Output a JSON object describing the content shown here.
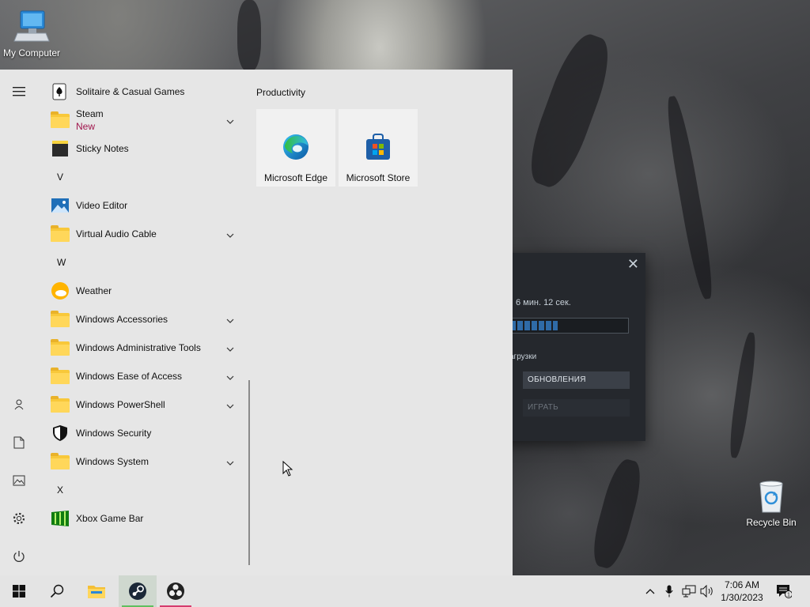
{
  "desktop": {
    "icons": [
      {
        "label": "My Computer"
      },
      {
        "label": "Recycle Bin"
      }
    ]
  },
  "steam_window": {
    "close_glyph": "✕",
    "time_remaining": "6 мин. 12 сек.",
    "progress_fraction": 0.4,
    "downloads_label": "агрузки",
    "update_button": "ОБНОВЛЕНИЯ",
    "play_button": "ИГРАТЬ"
  },
  "start_menu": {
    "apps": [
      {
        "label": "Solitaire & Casual Games",
        "icon": "solitaire-icon"
      },
      {
        "label": "Steam",
        "sublabel": "New",
        "icon": "folder-icon",
        "expandable": true
      },
      {
        "label": "Sticky Notes",
        "icon": "sticky-notes-icon"
      },
      {
        "letter": "V"
      },
      {
        "label": "Video Editor",
        "icon": "video-editor-icon"
      },
      {
        "label": "Virtual Audio Cable",
        "icon": "folder-icon",
        "expandable": true
      },
      {
        "letter": "W"
      },
      {
        "label": "Weather",
        "icon": "weather-icon"
      },
      {
        "label": "Windows Accessories",
        "icon": "folder-icon",
        "expandable": true
      },
      {
        "label": "Windows Administrative Tools",
        "icon": "folder-icon",
        "expandable": true
      },
      {
        "label": "Windows Ease of Access",
        "icon": "folder-icon",
        "expandable": true
      },
      {
        "label": "Windows PowerShell",
        "icon": "folder-icon",
        "expandable": true
      },
      {
        "label": "Windows Security",
        "icon": "shield-icon"
      },
      {
        "label": "Windows System",
        "icon": "folder-icon",
        "expandable": true
      },
      {
        "letter": "X"
      },
      {
        "label": "Xbox Game Bar",
        "icon": "xbox-game-bar-icon"
      }
    ],
    "group_title": "Productivity",
    "tiles": [
      {
        "label": "Microsoft Edge",
        "icon": "edge-icon"
      },
      {
        "label": "Microsoft Store",
        "icon": "store-icon"
      }
    ]
  },
  "taskbar": {
    "clock_time": "7:06 AM",
    "clock_date": "1/30/2023",
    "notification_count": "1"
  },
  "colors": {
    "accent_new": "#a0144c",
    "steam_active_underline": "#5fbf5f",
    "obs_active_underline": "#d43c6e"
  }
}
